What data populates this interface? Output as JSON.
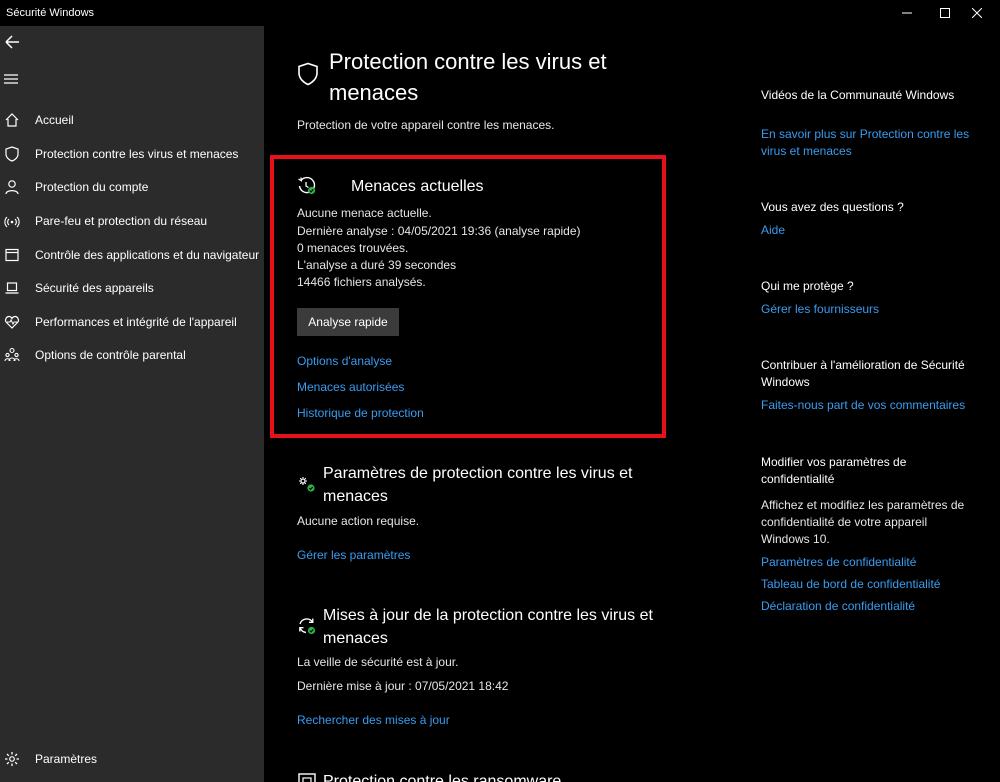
{
  "window": {
    "title": "Sécurité Windows"
  },
  "sidebar": {
    "items": [
      {
        "label": "Accueil",
        "icon": "home-icon"
      },
      {
        "label": "Protection contre les virus et menaces",
        "icon": "shield-icon"
      },
      {
        "label": "Protection du compte",
        "icon": "person-icon"
      },
      {
        "label": "Pare-feu et protection du réseau",
        "icon": "wifi-icon"
      },
      {
        "label": "Contrôle des applications et du navigateur",
        "icon": "app-window-icon"
      },
      {
        "label": "Sécurité des appareils",
        "icon": "laptop-icon"
      },
      {
        "label": "Performances et intégrité de l'appareil",
        "icon": "heart-icon"
      },
      {
        "label": "Options de contrôle parental",
        "icon": "family-icon"
      }
    ],
    "settings_label": "Paramètres"
  },
  "main": {
    "title": "Protection contre les virus et menaces",
    "subtitle": "Protection de votre appareil contre les menaces.",
    "current_threats": {
      "title": "Menaces actuelles",
      "lines": [
        "Aucune menace actuelle.",
        "Dernière analyse : 04/05/2021 19:36 (analyse rapide)",
        "0 menaces trouvées.",
        "L'analyse a duré 39 secondes",
        "14466 fichiers analysés."
      ],
      "button": "Analyse rapide",
      "links": [
        "Options d'analyse",
        "Menaces autorisées",
        "Historique de protection"
      ]
    },
    "settings_section": {
      "title": "Paramètres de protection contre les virus et menaces",
      "status": "Aucune action requise.",
      "link": "Gérer les paramètres"
    },
    "updates_section": {
      "title": "Mises à jour de la protection contre les virus et menaces",
      "status": "La veille de sécurité est à jour.",
      "last_update": "Dernière mise à jour : 07/05/2021 18:42",
      "link": "Rechercher des mises à jour"
    },
    "ransomware_section": {
      "title": "Protection contre les ransomware"
    }
  },
  "right": {
    "community": {
      "heading": "Vidéos de la Communauté Windows",
      "link": "En savoir plus sur Protection contre les virus et menaces"
    },
    "questions": {
      "heading": "Vous avez des questions ?",
      "link": "Aide"
    },
    "who": {
      "heading": "Qui me protège ?",
      "link": "Gérer les fournisseurs"
    },
    "contribute": {
      "heading": "Contribuer à l'amélioration de Sécurité Windows",
      "link": "Faites-nous part de vos commentaires"
    },
    "privacy": {
      "heading": "Modifier vos paramètres de confidentialité",
      "text": "Affichez et modifiez les paramètres de confidentialité de votre appareil Windows 10.",
      "links": [
        "Paramètres de confidentialité",
        "Tableau de bord de confidentialité",
        "Déclaration de confidentialité"
      ]
    }
  },
  "colors": {
    "accent_link": "#3a9cf0",
    "highlight": "#e8101a",
    "ok_green": "#2fb344",
    "sidebar_bg": "#2b2b2b"
  }
}
